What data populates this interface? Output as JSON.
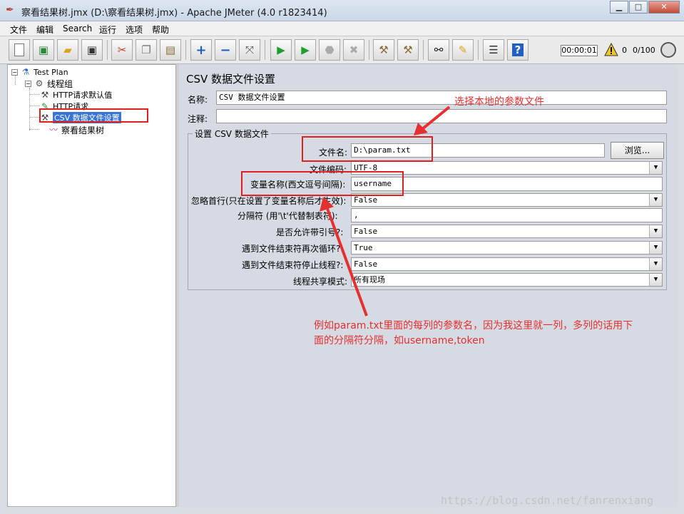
{
  "window": {
    "title": "察看结果树.jmx (D:\\察看结果树.jmx) - Apache JMeter (4.0 r1823414)",
    "minimize": "▁",
    "maximize": "□",
    "close": "✕"
  },
  "menu": [
    "文件",
    "编辑",
    "Search",
    "运行",
    "选项",
    "帮助"
  ],
  "toolbar": {
    "icons": [
      "new-icon",
      "templates-icon",
      "open-icon",
      "save-icon",
      "cut-icon",
      "copy-icon",
      "paste-icon",
      "expand-icon",
      "collapse-icon",
      "toggle-icon",
      "start-icon",
      "start-no-pause-icon",
      "stop-icon",
      "shutdown-icon",
      "clear-icon",
      "clear-all-icon",
      "search-icon",
      "reset-search-icon",
      "function-helper-icon",
      "help-icon"
    ],
    "timer": "00:00:01",
    "error_count": "0",
    "threads": "0/100"
  },
  "tree": {
    "test_plan": "Test Plan",
    "thread_group": "线程组",
    "http_defaults": "HTTP请求默认值",
    "http_request": "HTTP请求",
    "csv_config": "CSV 数据文件设置",
    "results_tree": "察看结果树",
    "toggle_minus": "−"
  },
  "panel": {
    "title": "CSV 数据文件设置",
    "name_label": "名称:",
    "name_value": "CSV 数据文件设置",
    "comment_label": "注释:",
    "comment_value": "",
    "section_title": "设置 CSV 数据文件",
    "filename_label": "文件名:",
    "filename_value": "D:\\param.txt",
    "browse_label": "浏览...",
    "encoding_label": "文件编码:",
    "encoding_value": "UTF-8",
    "varnames_label": "变量名称(西文逗号间隔):",
    "varnames_value": "username",
    "ignore_first_label": "忽略首行(只在设置了变量名称后才生效):",
    "ignore_first_value": "False",
    "delimiter_label": "分隔符 (用'\\t'代替制表符):",
    "delimiter_value": ",",
    "quoted_label": "是否允许带引号?:",
    "quoted_value": "False",
    "recycle_label": "遇到文件结束符再次循环?:",
    "recycle_value": "True",
    "stop_thread_label": "遇到文件结束符停止线程?:",
    "stop_thread_value": "False",
    "sharing_label": "线程共享模式:",
    "sharing_value": "所有现场"
  },
  "annotations": {
    "choose_file": "选择本地的参数文件",
    "explain_line1": "例如param.txt里面的每列的参数名，因为我这里就一列，多列的话用下",
    "explain_line2": "面的分隔符分隔，如username,token"
  },
  "watermark": "https://blog.csdn.net/fanrenxiang",
  "colors": {
    "annotation": "#e53030",
    "selection": "#3875d7"
  }
}
